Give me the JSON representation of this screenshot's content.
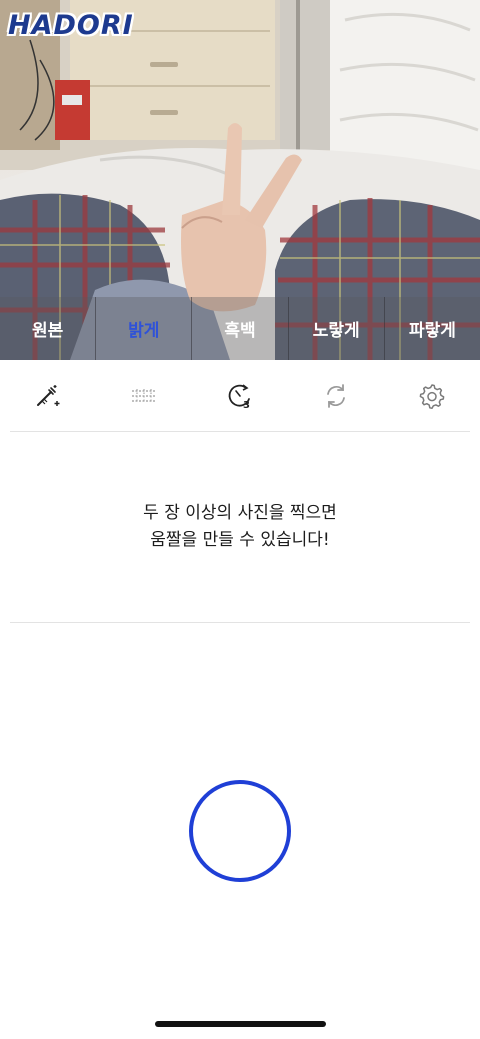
{
  "app": {
    "logo_text": "HADORI"
  },
  "filters": [
    {
      "label": "원본",
      "active": false
    },
    {
      "label": "밝게",
      "active": true
    },
    {
      "label": "흑백",
      "active": false
    },
    {
      "label": "노랗게",
      "active": false
    },
    {
      "label": "파랗게",
      "active": false
    }
  ],
  "toolbar": [
    {
      "icon": "magic-wand-icon"
    },
    {
      "icon": "grid-icon"
    },
    {
      "icon": "timer-3-icon"
    },
    {
      "icon": "switch-camera-icon"
    },
    {
      "icon": "gear-icon"
    }
  ],
  "message": {
    "line1": "두 장 이상의 사진을 찍으면",
    "line2": "움짤을 만들 수 있습니다!"
  },
  "colors": {
    "accent": "#1f3fd6",
    "active_filter": "#2f52d8"
  }
}
